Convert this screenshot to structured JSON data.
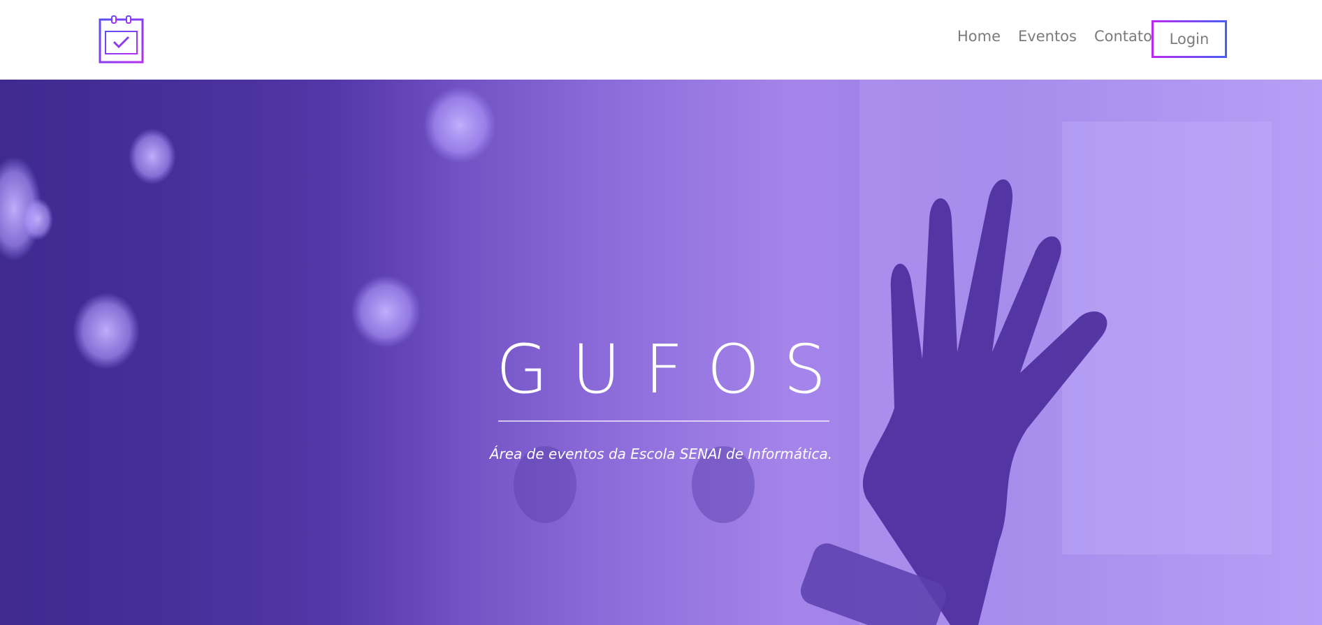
{
  "header": {
    "logo_icon": "calendar-check-icon",
    "nav": [
      {
        "label": "Home"
      },
      {
        "label": "Eventos"
      },
      {
        "label": "Contato"
      }
    ],
    "login_label": "Login"
  },
  "hero": {
    "title": "GUFOS",
    "subtitle": "Área de eventos da Escola SENAI de Informática.",
    "background_image": "hand-raised-photo",
    "overlay_color": "#7b55d9"
  },
  "colors": {
    "accent_gradient_start": "#b82cf0",
    "accent_gradient_end": "#4d5cf7",
    "nav_text": "#7b7b7b"
  }
}
